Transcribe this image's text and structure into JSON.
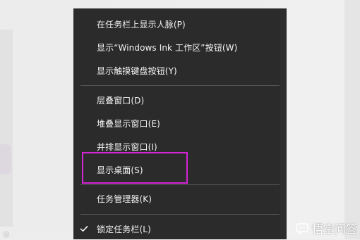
{
  "menu": {
    "items": [
      {
        "label": "在任务栏上显示人脉(P)"
      },
      {
        "label": "显示“Windows Ink 工作区”按钮(W)"
      },
      {
        "label": "显示触摸键盘按钮(Y)"
      },
      {
        "label": "层叠窗口(D)"
      },
      {
        "label": "堆叠显示窗口(E)"
      },
      {
        "label": "并排显示窗口(I)"
      },
      {
        "label": "显示桌面(S)"
      },
      {
        "label": "任务管理器(K)"
      },
      {
        "label": "锁定任务栏(L)",
        "checked": true
      }
    ]
  },
  "watermark": {
    "text": "悟空问答"
  },
  "colors": {
    "menu_background": "#2b2b2b",
    "menu_text": "#f4f4f4",
    "separator": "#555555",
    "highlight": "#d425d6"
  }
}
